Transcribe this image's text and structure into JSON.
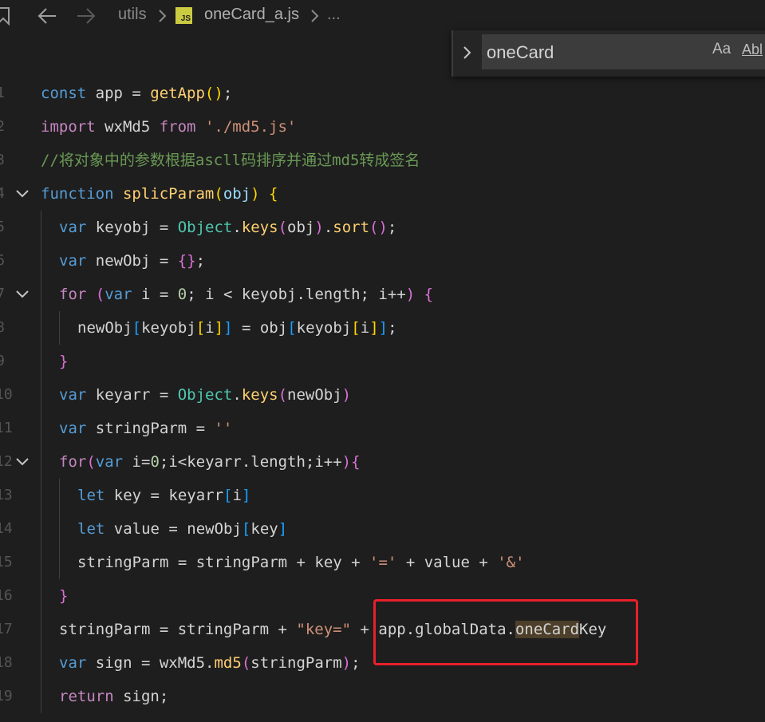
{
  "breadcrumb": {
    "folder": "utils",
    "file": "oneCard_a.js",
    "file_icon": "JS",
    "more": "..."
  },
  "find_widget": {
    "query": "oneCard",
    "match_case_label": "Aa",
    "whole_word_label": "Abl"
  },
  "colors": {
    "highlight_box": "#e8202a",
    "match_highlight": "#4d3f2a",
    "keyword": "#569cd6",
    "function": "#ffd070",
    "comment": "#6a9955"
  },
  "lines": [
    {
      "num": "1",
      "indent": 0,
      "fold": false,
      "tokens": [
        {
          "t": "const",
          "c": "t-kw2"
        },
        {
          "t": " app = ",
          "c": "t-id"
        },
        {
          "t": "getApp",
          "c": "t-fnc"
        },
        {
          "t": "()",
          "c": "t-br1"
        },
        {
          "t": ";",
          "c": "t-pun"
        }
      ]
    },
    {
      "num": "2",
      "indent": 0,
      "fold": false,
      "tokens": [
        {
          "t": "import",
          "c": "t-ctl"
        },
        {
          "t": " wxMd5 ",
          "c": "t-id"
        },
        {
          "t": "from",
          "c": "t-ctl"
        },
        {
          "t": " ",
          "c": "t-id"
        },
        {
          "t": "'./md5.js'",
          "c": "t-strq"
        }
      ]
    },
    {
      "num": "3",
      "indent": 0,
      "fold": false,
      "tokens": [
        {
          "t": "//将对象中的参数根据ascll码排序并通过md5转成签名",
          "c": "t-cmt"
        }
      ]
    },
    {
      "num": "4",
      "indent": 0,
      "fold": true,
      "tokens": [
        {
          "t": "function",
          "c": "t-kw2"
        },
        {
          "t": " ",
          "c": "t-id"
        },
        {
          "t": "splicParam",
          "c": "t-fnc"
        },
        {
          "t": "(",
          "c": "t-br1"
        },
        {
          "t": "obj",
          "c": "t-prop"
        },
        {
          "t": ")",
          "c": "t-br1"
        },
        {
          "t": " ",
          "c": "t-id"
        },
        {
          "t": "{",
          "c": "t-br1"
        }
      ]
    },
    {
      "num": "5",
      "indent": 1,
      "fold": false,
      "tokens": [
        {
          "t": "var",
          "c": "t-kw2"
        },
        {
          "t": " keyobj = ",
          "c": "t-id"
        },
        {
          "t": "Object",
          "c": "t-cls"
        },
        {
          "t": ".",
          "c": "t-pun"
        },
        {
          "t": "keys",
          "c": "t-fnc"
        },
        {
          "t": "(",
          "c": "t-br2"
        },
        {
          "t": "obj",
          "c": "t-id"
        },
        {
          "t": ")",
          "c": "t-br2"
        },
        {
          "t": ".",
          "c": "t-pun"
        },
        {
          "t": "sort",
          "c": "t-fnc"
        },
        {
          "t": "()",
          "c": "t-br2"
        },
        {
          "t": ";",
          "c": "t-pun"
        }
      ]
    },
    {
      "num": "6",
      "indent": 1,
      "fold": false,
      "tokens": [
        {
          "t": "var",
          "c": "t-kw2"
        },
        {
          "t": " newObj = ",
          "c": "t-id"
        },
        {
          "t": "{}",
          "c": "t-br2"
        },
        {
          "t": ";",
          "c": "t-pun"
        }
      ]
    },
    {
      "num": "7",
      "indent": 1,
      "fold": true,
      "tokens": [
        {
          "t": "for",
          "c": "t-ctl"
        },
        {
          "t": " ",
          "c": "t-id"
        },
        {
          "t": "(",
          "c": "t-br2"
        },
        {
          "t": "var",
          "c": "t-kw2"
        },
        {
          "t": " i = ",
          "c": "t-id"
        },
        {
          "t": "0",
          "c": "t-num"
        },
        {
          "t": "; i < keyobj.length; i++",
          "c": "t-id"
        },
        {
          "t": ")",
          "c": "t-br2"
        },
        {
          "t": " ",
          "c": "t-id"
        },
        {
          "t": "{",
          "c": "t-br2"
        }
      ]
    },
    {
      "num": "8",
      "indent": 2,
      "fold": false,
      "tokens": [
        {
          "t": "newObj",
          "c": "t-id"
        },
        {
          "t": "[",
          "c": "t-br3"
        },
        {
          "t": "keyobj",
          "c": "t-id"
        },
        {
          "t": "[",
          "c": "t-br1"
        },
        {
          "t": "i",
          "c": "t-id"
        },
        {
          "t": "]",
          "c": "t-br1"
        },
        {
          "t": "]",
          "c": "t-br3"
        },
        {
          "t": " = obj",
          "c": "t-id"
        },
        {
          "t": "[",
          "c": "t-br3"
        },
        {
          "t": "keyobj",
          "c": "t-id"
        },
        {
          "t": "[",
          "c": "t-br1"
        },
        {
          "t": "i",
          "c": "t-id"
        },
        {
          "t": "]",
          "c": "t-br1"
        },
        {
          "t": "]",
          "c": "t-br3"
        },
        {
          "t": ";",
          "c": "t-pun"
        }
      ]
    },
    {
      "num": "9",
      "indent": 1,
      "fold": false,
      "tokens": [
        {
          "t": "}",
          "c": "t-br2"
        }
      ]
    },
    {
      "num": "10",
      "indent": 1,
      "fold": false,
      "tokens": [
        {
          "t": "var",
          "c": "t-kw2"
        },
        {
          "t": " keyarr = ",
          "c": "t-id"
        },
        {
          "t": "Object",
          "c": "t-cls"
        },
        {
          "t": ".",
          "c": "t-pun"
        },
        {
          "t": "keys",
          "c": "t-fnc"
        },
        {
          "t": "(",
          "c": "t-br2"
        },
        {
          "t": "newObj",
          "c": "t-id"
        },
        {
          "t": ")",
          "c": "t-br2"
        }
      ]
    },
    {
      "num": "11",
      "indent": 1,
      "fold": false,
      "tokens": [
        {
          "t": "var",
          "c": "t-kw2"
        },
        {
          "t": " stringParm = ",
          "c": "t-id"
        },
        {
          "t": "''",
          "c": "t-strq"
        }
      ]
    },
    {
      "num": "12",
      "indent": 1,
      "fold": true,
      "tokens": [
        {
          "t": "for",
          "c": "t-ctl"
        },
        {
          "t": "(",
          "c": "t-br2"
        },
        {
          "t": "var",
          "c": "t-kw2"
        },
        {
          "t": " i=",
          "c": "t-id"
        },
        {
          "t": "0",
          "c": "t-num"
        },
        {
          "t": ";i<keyarr.length;i++",
          "c": "t-id"
        },
        {
          "t": ")",
          "c": "t-br2"
        },
        {
          "t": "{",
          "c": "t-br2"
        }
      ]
    },
    {
      "num": "13",
      "indent": 2,
      "fold": false,
      "tokens": [
        {
          "t": "let",
          "c": "t-kw2"
        },
        {
          "t": " key = keyarr",
          "c": "t-id"
        },
        {
          "t": "[",
          "c": "t-br3"
        },
        {
          "t": "i",
          "c": "t-id"
        },
        {
          "t": "]",
          "c": "t-br3"
        }
      ]
    },
    {
      "num": "14",
      "indent": 2,
      "fold": false,
      "tokens": [
        {
          "t": "let",
          "c": "t-kw2"
        },
        {
          "t": " value = newObj",
          "c": "t-id"
        },
        {
          "t": "[",
          "c": "t-br3"
        },
        {
          "t": "key",
          "c": "t-id"
        },
        {
          "t": "]",
          "c": "t-br3"
        }
      ]
    },
    {
      "num": "15",
      "indent": 2,
      "fold": false,
      "tokens": [
        {
          "t": "stringParm = stringParm + key + ",
          "c": "t-id"
        },
        {
          "t": "'='",
          "c": "t-strq"
        },
        {
          "t": " + value + ",
          "c": "t-id"
        },
        {
          "t": "'&'",
          "c": "t-strq"
        }
      ]
    },
    {
      "num": "16",
      "indent": 1,
      "fold": false,
      "tokens": [
        {
          "t": "}",
          "c": "t-br2"
        }
      ]
    },
    {
      "num": "17",
      "indent": 1,
      "fold": false,
      "tokens": [
        {
          "t": "stringParm = stringParm + ",
          "c": "t-id"
        },
        {
          "t": "\"key=\"",
          "c": "t-strq"
        },
        {
          "t": " + app.globalData.",
          "c": "t-id"
        },
        {
          "t": "oneCard",
          "c": "t-id",
          "hl": true
        },
        {
          "t": "Key",
          "c": "t-id"
        }
      ]
    },
    {
      "num": "18",
      "indent": 1,
      "fold": false,
      "tokens": [
        {
          "t": "var",
          "c": "t-kw2"
        },
        {
          "t": " sign = wxMd5.",
          "c": "t-id"
        },
        {
          "t": "md5",
          "c": "t-fnc"
        },
        {
          "t": "(",
          "c": "t-br2"
        },
        {
          "t": "stringParm",
          "c": "t-id"
        },
        {
          "t": ")",
          "c": "t-br2"
        },
        {
          "t": ";",
          "c": "t-pun"
        }
      ]
    },
    {
      "num": "19",
      "indent": 1,
      "fold": false,
      "tokens": [
        {
          "t": "return",
          "c": "t-ctl"
        },
        {
          "t": " sign;",
          "c": "t-id"
        }
      ]
    }
  ]
}
